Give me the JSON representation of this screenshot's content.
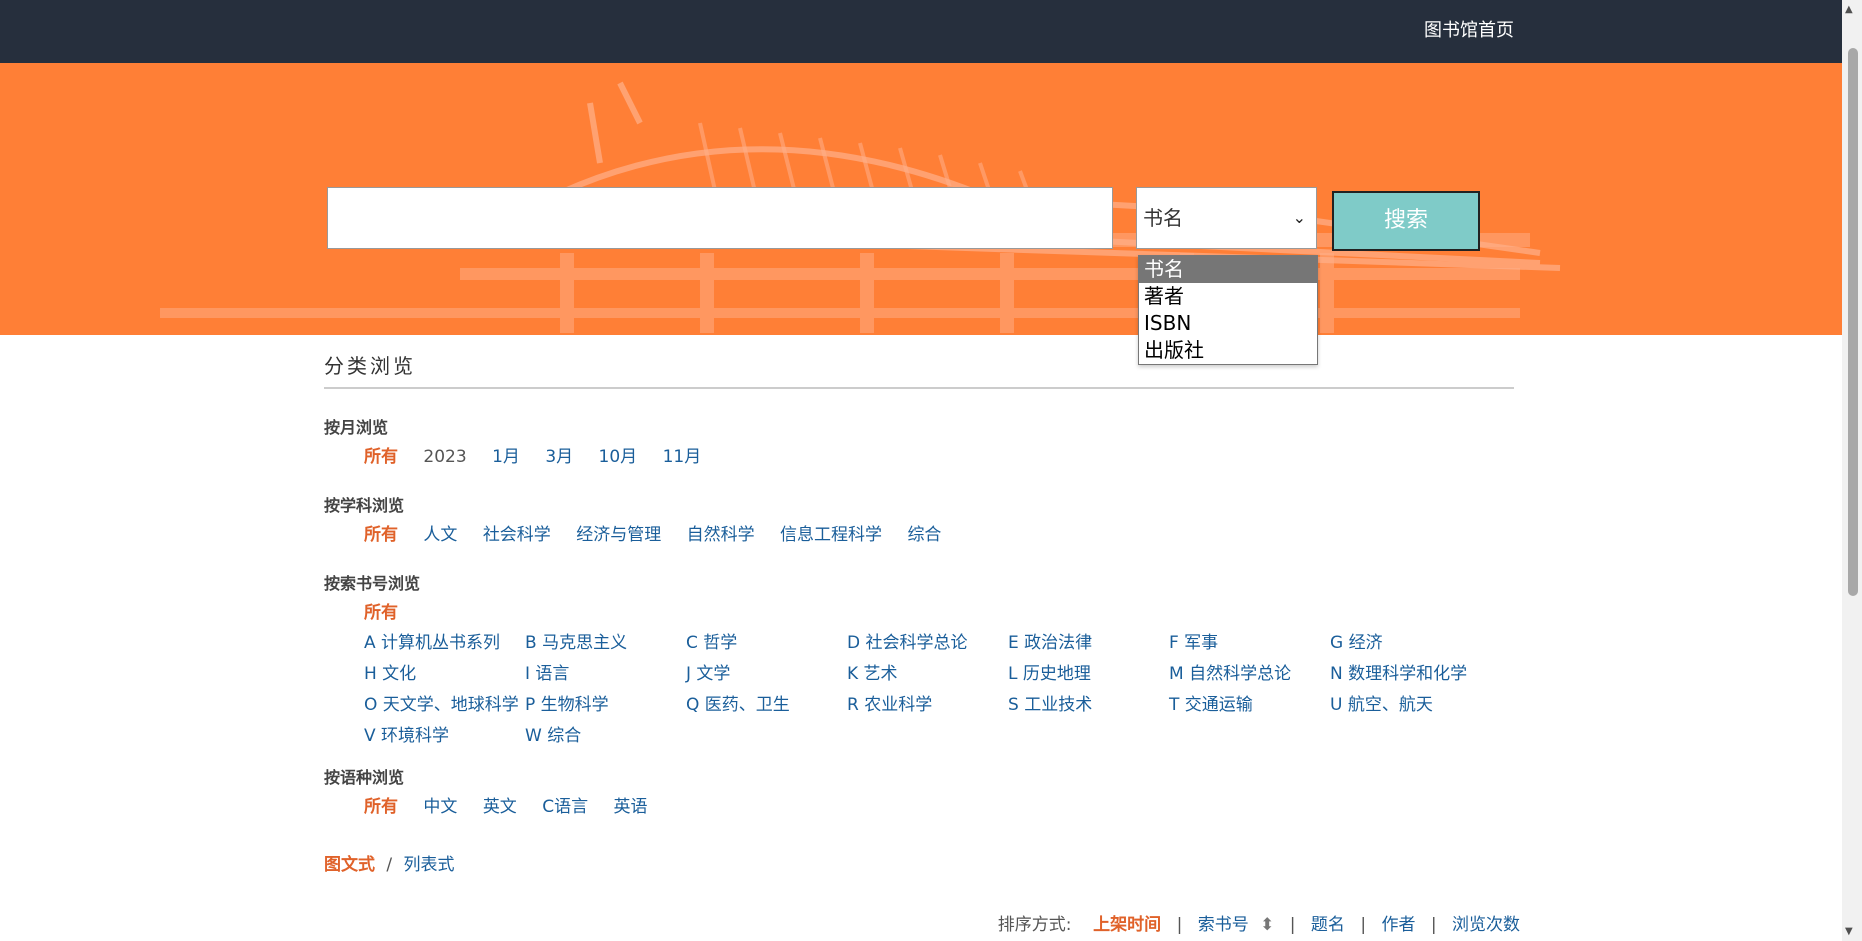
{
  "topbar": {
    "home_link": "图书馆首页"
  },
  "search": {
    "placeholder": "",
    "field_selected": "书名",
    "button_label": "搜索",
    "field_options": [
      "书名",
      "著者",
      "ISBN",
      "出版社"
    ]
  },
  "browse": {
    "heading": "分类浏览",
    "by_month": {
      "title": "按月浏览",
      "items": [
        "所有",
        "2023",
        "1月",
        "3月",
        "10月",
        "11月"
      ]
    },
    "by_subject": {
      "title": "按学科浏览",
      "items": [
        "所有",
        "人文",
        "社会科学",
        "经济与管理",
        "自然科学",
        "信息工程科学",
        "综合"
      ]
    },
    "by_callno": {
      "title": "按索书号浏览",
      "all": "所有",
      "items": [
        "A 计算机丛书系列",
        "B 马克思主义",
        "C 哲学",
        "D 社会科学总论",
        "E 政治法律",
        "F 军事",
        "G 经济",
        "H 文化",
        "I 语言",
        "J 文学",
        "K 艺术",
        "L 历史地理",
        "M 自然科学总论",
        "N 数理科学和化学",
        "O 天文学、地球科学",
        "P 生物科学",
        "Q 医药、卫生",
        "R 农业科学",
        "S 工业技术",
        "T 交通运输",
        "U 航空、航天",
        "V 环境科学",
        "W 综合"
      ]
    },
    "by_language": {
      "title": "按语种浏览",
      "items": [
        "所有",
        "中文",
        "英文",
        "C语言",
        "英语"
      ]
    }
  },
  "view_toggle": {
    "active": "图文式",
    "separator": "/",
    "other": "列表式"
  },
  "sort": {
    "label": "排序方式:",
    "options": [
      "上架时间",
      "索书号",
      "题名",
      "作者",
      "浏览次数"
    ],
    "sort_icon": "⬍"
  },
  "colors": {
    "topbar": "#262f3d",
    "hero": "#ff7f36",
    "search_button": "#7fcbc8",
    "accent": "#e0622a",
    "link": "#1a5e9a"
  }
}
